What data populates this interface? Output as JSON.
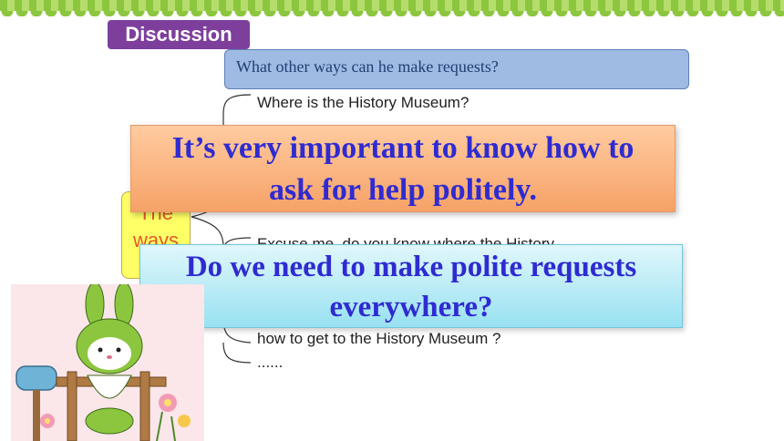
{
  "header": {
    "tag_label": "Discussion"
  },
  "question": {
    "text": "What other ways can he make requests?"
  },
  "ways_box": {
    "line1": "The",
    "line2": "ways"
  },
  "examples": [
    "Where is the History Museum?",
    "Excuse me, do you know where the History",
    "how to get to the History Museum ?",
    "......"
  ],
  "overlay_important": {
    "line1": "It’s very important to know how to",
    "line2": "ask for help politely."
  },
  "overlay_question": {
    "line1": "Do we need to make polite requests",
    "line2": "everywhere?"
  },
  "colors": {
    "tag_bg": "#7e3f9c",
    "question_bg": "#9fbbe3",
    "overlay1_bg": "#f6a267",
    "overlay2_bg": "#98e1f1",
    "overlay_text": "#2f2bd1",
    "ways_text": "#e05a2b"
  }
}
